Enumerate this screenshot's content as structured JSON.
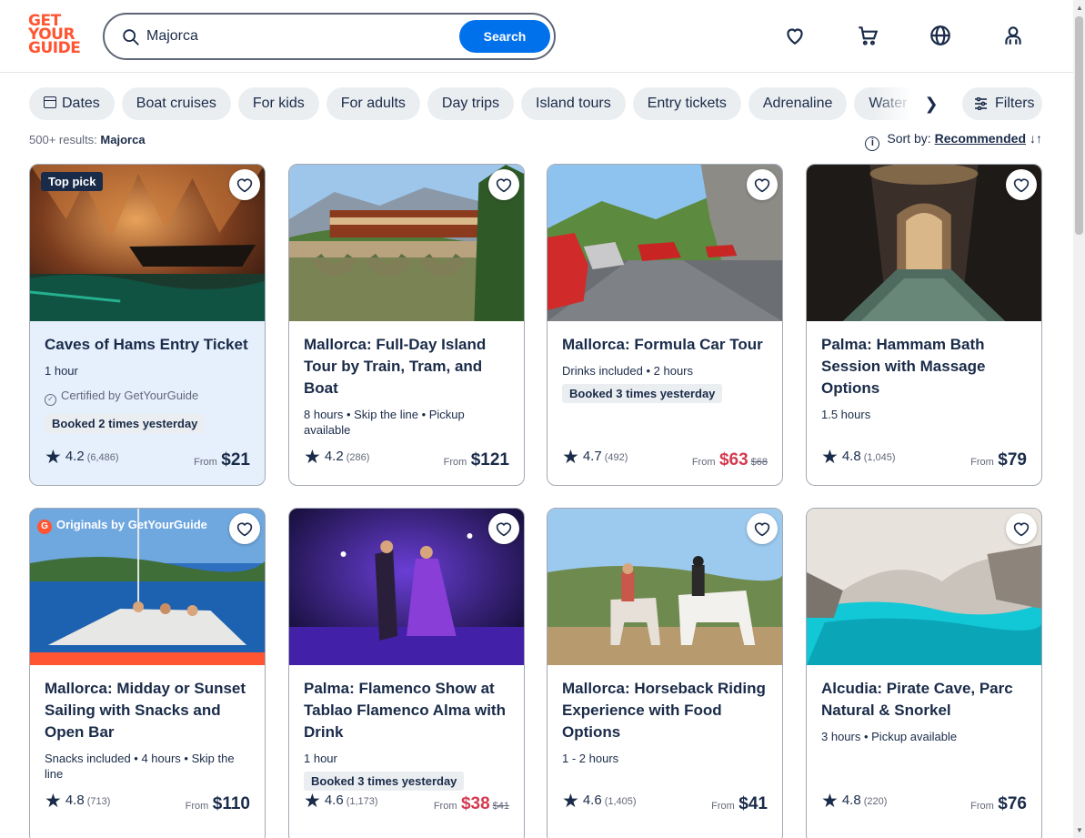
{
  "header": {
    "logo_lines": [
      "GET",
      "YOUR",
      "GUIDE"
    ],
    "search_value": "Majorca",
    "search_button": "Search",
    "icons": [
      "heart-icon",
      "cart-icon",
      "globe-icon",
      "profile-icon"
    ]
  },
  "chips": [
    "Dates",
    "Boat cruises",
    "For kids",
    "For adults",
    "Day trips",
    "Island tours",
    "Entry tickets",
    "Adrenaline",
    "Water sports"
  ],
  "filters_label": "Filters",
  "results": {
    "count": "500+ results:",
    "query": "Majorca"
  },
  "sort": {
    "label": "Sort by:",
    "value": "Recommended"
  },
  "cards": [
    {
      "title": "Caves of Hams Entry Ticket",
      "meta": "1 hour",
      "badge": "Top pick",
      "certified": "Certified by GetYourGuide",
      "booked": "Booked 2 times yesterday",
      "rating": "4.2",
      "count": "(6,486)",
      "from": "From",
      "price": "$21",
      "old_price": ""
    },
    {
      "title": "Mallorca: Full-Day Island Tour by Train, Tram, and Boat",
      "meta": "8 hours • Skip the line • Pickup available",
      "rating": "4.2",
      "count": "(286)",
      "from": "From",
      "price": "$121",
      "old_price": ""
    },
    {
      "title": "Mallorca: Formula Car Tour",
      "meta": "Drinks included • 2 hours",
      "booked": "Booked 3 times yesterday",
      "rating": "4.7",
      "count": "(492)",
      "from": "From",
      "price": "$63",
      "old_price": "$68"
    },
    {
      "title": "Palma: Hammam Bath Session with Massage Options",
      "meta": "1.5 hours",
      "rating": "4.8",
      "count": "(1,045)",
      "from": "From",
      "price": "$79",
      "old_price": ""
    },
    {
      "title": "Mallorca: Midday or Sunset Sailing with Snacks and Open Bar",
      "meta": "Snacks included • 4 hours • Skip the line",
      "originals": "Originals by GetYourGuide",
      "originals_mark": "G",
      "rating": "4.8",
      "count": "(713)",
      "from": "From",
      "price": "$110",
      "old_price": ""
    },
    {
      "title": "Palma: Flamenco Show at Tablao Flamenco Alma with Drink",
      "meta": "1 hour",
      "booked": "Booked 3 times yesterday",
      "rating": "4.6",
      "count": "(1,173)",
      "from": "From",
      "price": "$38",
      "old_price": "$41"
    },
    {
      "title": "Mallorca: Horseback Riding Experience with Food Options",
      "meta": "1 - 2 hours",
      "rating": "4.6",
      "count": "(1,405)",
      "from": "From",
      "price": "$41",
      "old_price": ""
    },
    {
      "title": "Alcudia: Pirate Cave, Parc Natural & Snorkel",
      "meta": "3 hours • Pickup available",
      "rating": "4.8",
      "count": "(220)",
      "from": "From",
      "price": "$76",
      "old_price": ""
    }
  ],
  "colors": {
    "brand": "#ff5533",
    "primary_blue": "#0071eb",
    "sale_red": "#d43a50",
    "text": "#1a2b49"
  }
}
